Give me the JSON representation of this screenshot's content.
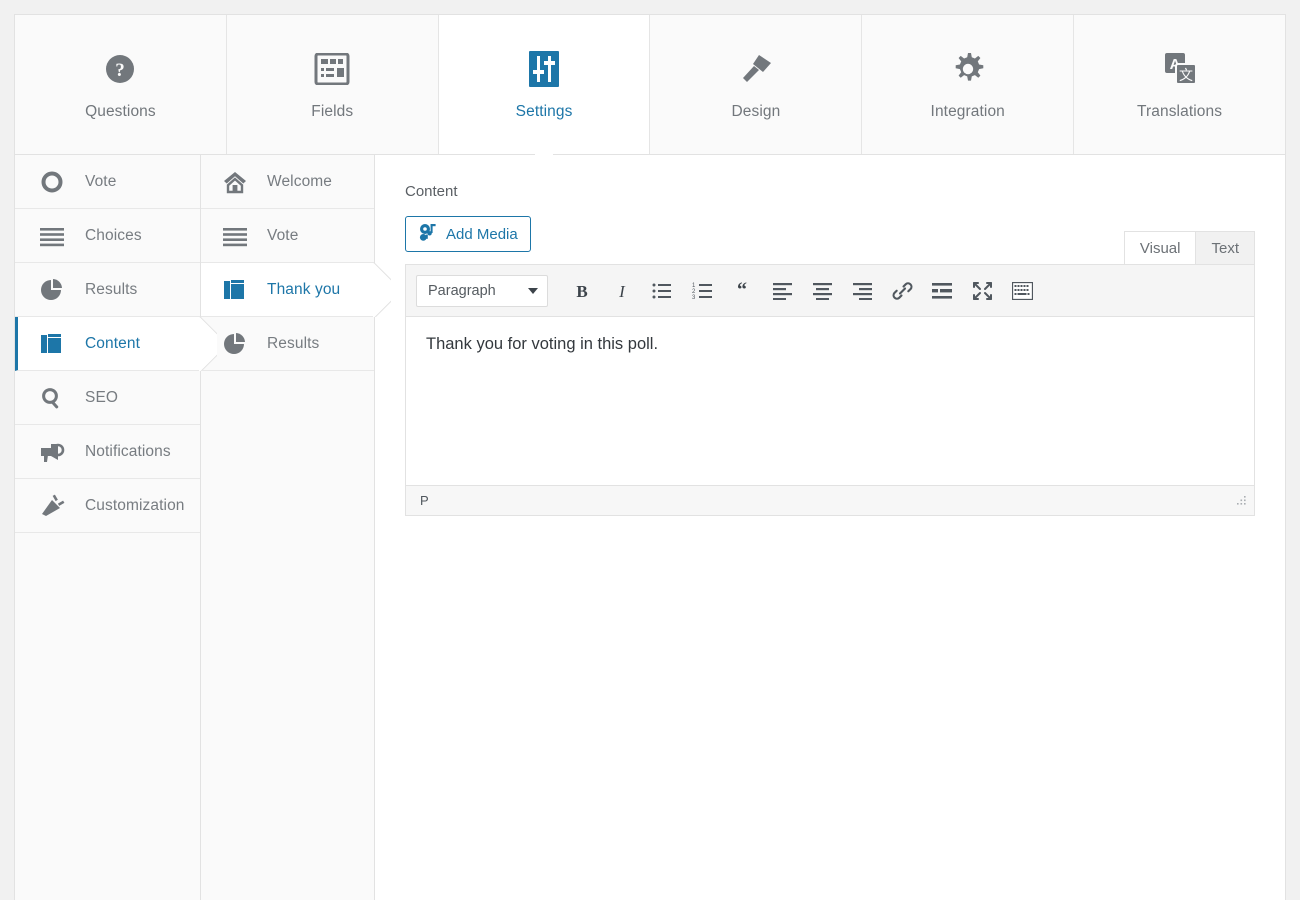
{
  "tabs": [
    {
      "label": "Questions",
      "icon": "question-circle-icon",
      "active": false
    },
    {
      "label": "Fields",
      "icon": "form-fields-icon",
      "active": false
    },
    {
      "label": "Settings",
      "icon": "sliders-icon",
      "active": true
    },
    {
      "label": "Design",
      "icon": "paintbrush-icon",
      "active": false
    },
    {
      "label": "Integration",
      "icon": "gear-icon",
      "active": false
    },
    {
      "label": "Translations",
      "icon": "translate-icon",
      "active": false
    }
  ],
  "sidebar_primary": {
    "items": [
      {
        "label": "Vote",
        "icon": "circle-icon",
        "active": false
      },
      {
        "label": "Choices",
        "icon": "list-lines-icon",
        "active": false
      },
      {
        "label": "Results",
        "icon": "pie-chart-icon",
        "active": false
      },
      {
        "label": "Content",
        "icon": "pages-icon",
        "active": true
      },
      {
        "label": "SEO",
        "icon": "magnifier-icon",
        "active": false
      },
      {
        "label": "Notifications",
        "icon": "megaphone-icon",
        "active": false
      },
      {
        "label": "Customization",
        "icon": "plug-icon",
        "active": false
      }
    ]
  },
  "sidebar_secondary": {
    "items": [
      {
        "label": "Welcome",
        "icon": "home-icon",
        "active": false
      },
      {
        "label": "Vote",
        "icon": "list-lines-icon",
        "active": false
      },
      {
        "label": "Thank you",
        "icon": "pages-icon",
        "active": true
      },
      {
        "label": "Results",
        "icon": "pie-chart-icon",
        "active": false
      }
    ]
  },
  "main": {
    "content_label": "Content",
    "add_media_label": "Add Media",
    "editor": {
      "mode_tabs": [
        {
          "label": "Visual",
          "active": true
        },
        {
          "label": "Text",
          "active": false
        }
      ],
      "format_select_value": "Paragraph",
      "toolbar_buttons": [
        {
          "name": "bold-icon",
          "title": "Bold"
        },
        {
          "name": "italic-icon",
          "title": "Italic"
        },
        {
          "name": "bulleted-list-icon",
          "title": "Bulleted list"
        },
        {
          "name": "numbered-list-icon",
          "title": "Numbered list"
        },
        {
          "name": "blockquote-icon",
          "title": "Blockquote"
        },
        {
          "name": "align-left-icon",
          "title": "Align left"
        },
        {
          "name": "align-center-icon",
          "title": "Align center"
        },
        {
          "name": "align-right-icon",
          "title": "Align right"
        },
        {
          "name": "link-icon",
          "title": "Insert link"
        },
        {
          "name": "read-more-icon",
          "title": "Insert Read More tag"
        },
        {
          "name": "fullscreen-icon",
          "title": "Distraction-free writing mode"
        },
        {
          "name": "toolbar-toggle-icon",
          "title": "Toolbar Toggle"
        }
      ],
      "body_text": "Thank you for voting in this poll.",
      "status_path": "P",
      "resize_handle": "resize-handle-icon"
    }
  },
  "colors": {
    "accent": "#1d76a8",
    "icon_gray": "#72777c",
    "text_gray": "#777c81",
    "panel_bg": "#fafafa",
    "page_bg": "#f1f1f1",
    "border": "#e2e2e2"
  }
}
